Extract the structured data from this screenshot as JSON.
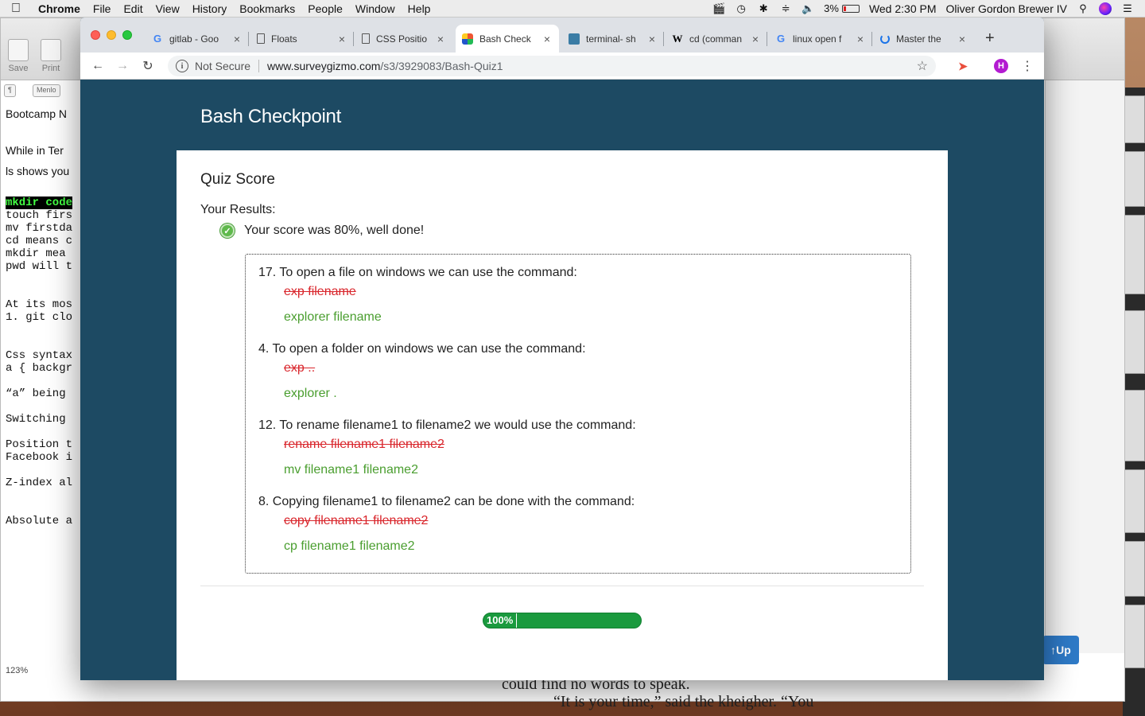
{
  "menubar": {
    "app": "Chrome",
    "items": [
      "File",
      "Edit",
      "View",
      "History",
      "Bookmarks",
      "People",
      "Window",
      "Help"
    ],
    "battery": "3%",
    "clock": "Wed 2:30 PM",
    "user": "Oliver Gordon Brewer IV"
  },
  "editor": {
    "toolbar": {
      "save": "Save",
      "print": "Print"
    },
    "format": {
      "para": "¶",
      "font": "Menlo"
    },
    "lines": [
      "Bootcamp N",
      "While in Ter",
      "ls shows you",
      "mkdir code",
      "touch firs",
      "mv firstda",
      "cd means c",
      "mkdir  mea",
      "pwd will t",
      "At its mos",
      "1. git clo",
      "Css syntax",
      "a { backgr",
      "“a” being",
      "Switching",
      "Position t",
      "Facebook i",
      "Z-index al",
      "Absolute a"
    ],
    "zoom": "123%",
    "up_button": "Up",
    "bottom_line1": "could find no words to speak.",
    "bottom_line2": "“It is your time,” said the kheigher. “You"
  },
  "browser": {
    "tabs": [
      {
        "title": "gitlab - Goo",
        "icon": "google-icon",
        "active": false
      },
      {
        "title": "Floats",
        "icon": "document-icon",
        "active": false
      },
      {
        "title": "CSS Positio",
        "icon": "document-icon",
        "active": false
      },
      {
        "title": "Bash Check",
        "icon": "surveygizmo-icon",
        "active": true
      },
      {
        "title": "terminal- sh",
        "icon": "terminal-site-icon",
        "active": false
      },
      {
        "title": "cd (comman",
        "icon": "wikipedia-icon",
        "active": false
      },
      {
        "title": "linux open f",
        "icon": "google-icon",
        "active": false
      },
      {
        "title": "Master the",
        "icon": "loading-icon",
        "active": false
      }
    ],
    "security_label": "Not Secure",
    "url_host": "www.surveygizmo.com",
    "url_path": "/s3/3929083/Bash-Quiz1",
    "profile_initial": "H"
  },
  "page": {
    "title": "Bash Checkpoint",
    "quiz_score_heading": "Quiz Score",
    "results_label": "Your Results:",
    "score_message": "Your score was 80%, well done!",
    "questions": [
      {
        "text": "17. To open a file on windows we can use the command:",
        "your_answer": "exp filename",
        "correct_answer": "explorer filename"
      },
      {
        "text": "4. To open a folder on windows we can use the command:",
        "your_answer": "exp ..",
        "correct_answer": "explorer ."
      },
      {
        "text": "12. To rename filename1 to filename2 we would use the command:",
        "your_answer": "rename filename1 filename2",
        "correct_answer": "mv filename1 filename2"
      },
      {
        "text": "8. Copying filename1 to filename2 can be done with the command:",
        "your_answer": "copy filename1 filename2",
        "correct_answer": "cp filename1 filename2"
      }
    ],
    "progress_label": "100%",
    "progress_value": 1.0
  },
  "colors": {
    "page_bg": "#1d4a63",
    "wrong": "#d9262c",
    "correct": "#4a9e2f",
    "progress": "#1a9a3e"
  }
}
